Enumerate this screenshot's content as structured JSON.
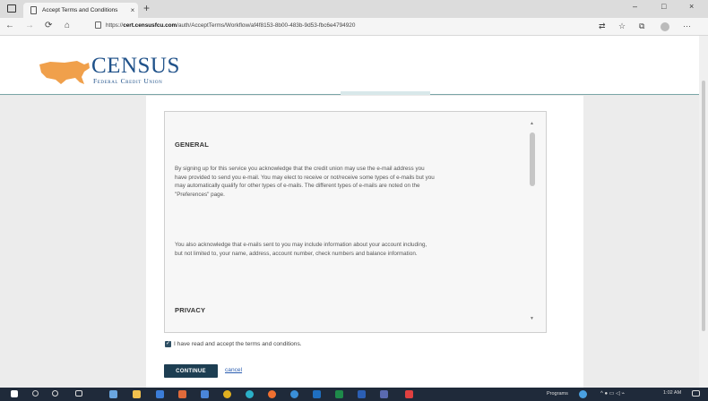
{
  "browser": {
    "tab_title": "Accept Terms and Conditions",
    "tab_close": "×",
    "new_tab": "+",
    "url_prefix": "https://",
    "url_domain": "cert.censusfcu.com",
    "url_path": "/auth/AcceptTerms/Workflow/af4f8153-8b00-483b-9d53-fbc6e4794920",
    "window_controls": [
      "–",
      "□",
      "×"
    ],
    "nav": {
      "back": "←",
      "forward": "→",
      "refresh": "⟳",
      "home": "⌂"
    },
    "toolbar_icons": [
      "translate-icon",
      "favorites-icon",
      "collections-icon",
      "profile-icon",
      "more-icon"
    ],
    "more_label": "···"
  },
  "header": {
    "brand": "CENSUS",
    "brand_sub": "Federal Credit Union",
    "colors": {
      "brand_blue": "#20528a",
      "map_orange": "#f0a04b"
    }
  },
  "terms": {
    "heading_general": "GENERAL",
    "paragraph_1": "By signing up for this service you acknowledge that the credit union may use the e-mail address you have provided to send you e-mail. You may elect to receive or not/receive some types of e-mails but you may automatically qualify for other types of e-mails. The different types of e-mails are noted on the \"Preferences\" page.",
    "paragraph_2": "You also acknowledge that e-mails sent to you may include information about your account including, but not limited to, your name, address, account number, check numbers and balance information.",
    "heading_privacy": "PRIVACY"
  },
  "form": {
    "accept_label": "I have read and accept the terms and conditions.",
    "accept_checked": true,
    "continue_label": "CONTINUE",
    "cancel_label": "cancel"
  },
  "taskbar": {
    "programs_label": "Programs",
    "clock_time": "1:02 AM",
    "icons": [
      "windows-start-icon",
      "search-icon",
      "cortana-icon",
      "task-view-icon",
      "people-icon",
      "file-explorer-icon",
      "app-icon",
      "app-icon",
      "app-icon",
      "chrome-icon",
      "app-icon",
      "firefox-icon",
      "edge-icon",
      "outlook-icon",
      "excel-icon",
      "word-icon",
      "app-icon",
      "app-icon"
    ]
  }
}
